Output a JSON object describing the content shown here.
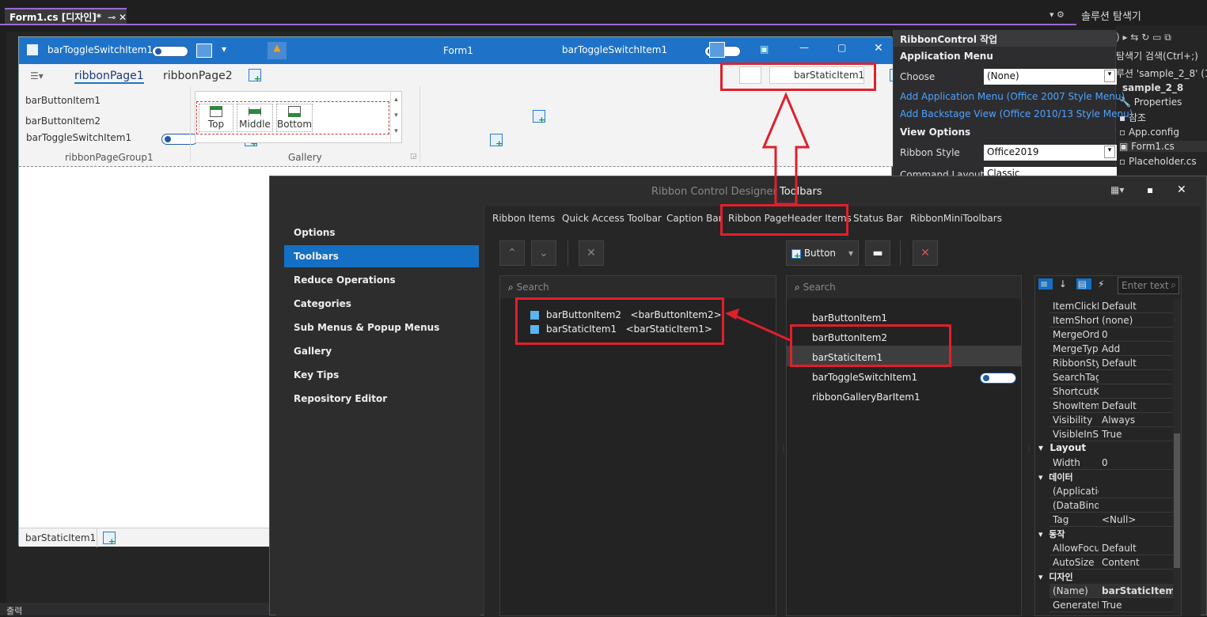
{
  "vs": {
    "doc_tab": "Form1.cs [디자인]*",
    "pin": "⊸ ✕",
    "solution_title": "솔루션 탐색기",
    "solution_search": "탐색기 검색(Ctrl+;)",
    "solution_line": "루션 'sample_2_8' (1",
    "project": "sample_2_8",
    "items": [
      "Properties",
      "참조",
      "App.config",
      "Form1.cs",
      "Placeholder.cs"
    ]
  },
  "smart_tag": {
    "title": "RibbonControl 작업",
    "app_menu_header": "Application Menu",
    "choose_label": "Choose",
    "choose_value": "(None)",
    "link1": "Add Application Menu (Office 2007 Style Menu)",
    "link2": "Add Backstage View (Office 2010/13 Style Menu)",
    "view_header": "View Options",
    "style_label": "Ribbon Style",
    "style_value": "Office2019",
    "cmd_label": "Command Layout",
    "cmd_value": "Classic"
  },
  "form": {
    "qat_toggle_label": "barToggleSwitchItem1",
    "title": "Form1",
    "caption_toggle_label": "barToggleSwitchItem1",
    "page_tabs": [
      "ribbonPage1",
      "ribbonPage2"
    ],
    "header_static": "barStaticItem1",
    "group1_items": [
      "barButtonItem1",
      "barButtonItem2",
      "barToggleSwitchItem1"
    ],
    "group1_label": "ribbonPageGroup1",
    "gallery_items": [
      "Top",
      "Middle",
      "Bottom"
    ],
    "gallery_label": "Gallery",
    "status_static": "barStaticItem1"
  },
  "designer": {
    "title_prefix": "Ribbon Control Designer",
    "title_section": "Toolbars",
    "nav": [
      "Options",
      "Toolbars",
      "Reduce Operations",
      "Categories",
      "Sub Menus & Popup Menus",
      "Gallery",
      "Key Tips",
      "Repository Editor"
    ],
    "selected_nav": "Toolbars",
    "tabs": [
      "Ribbon Items",
      "Quick Access Toolbar",
      "Caption Bar",
      "Ribbon PageHeader Items",
      "Status Bar",
      "RibbonMiniToolbars"
    ],
    "left_search": "Search",
    "right_search": "Search",
    "button_dropdown": "Button",
    "left_list": [
      {
        "name": "barButtonItem2",
        "tag": "<barButtonItem2>"
      },
      {
        "name": "barStaticItem1",
        "tag": "<barStaticItem1>"
      }
    ],
    "right_list": [
      "barButtonItem1",
      "barButtonItem2",
      "barStaticItem1",
      "barToggleSwitchItem1",
      "ribbonGalleryBarItem1"
    ],
    "prop_search": "Enter text",
    "props_top": [
      {
        "k": "ItemClickFi",
        "v": "Default"
      },
      {
        "k": "ItemShortc",
        "v": "(none)"
      },
      {
        "k": "MergeOrde",
        "v": "0"
      },
      {
        "k": "MergeType",
        "v": "Add"
      },
      {
        "k": "RibbonStyl",
        "v": "Default"
      },
      {
        "k": "SearchTag",
        "v": ""
      },
      {
        "k": "ShortcutKe",
        "v": ""
      },
      {
        "k": "ShowItem",
        "v": "Default"
      },
      {
        "k": "Visibility",
        "v": "Always"
      },
      {
        "k": "VisibleInSe",
        "v": "True"
      }
    ],
    "cat_layout": "Layout",
    "prop_width": {
      "k": "Width",
      "v": "0"
    },
    "cat_data": "데이터",
    "props_data": [
      {
        "k": "(Applicatio",
        "v": ""
      },
      {
        "k": "(DataBindi",
        "v": ""
      },
      {
        "k": "Tag",
        "v": "<Null>"
      }
    ],
    "cat_behavior": "동작",
    "props_behavior": [
      {
        "k": "AllowFocus",
        "v": "Default"
      },
      {
        "k": "AutoSize",
        "v": "Content"
      }
    ],
    "cat_design": "디자인",
    "props_design": [
      {
        "k": "(Name)",
        "v": "barStaticItem"
      },
      {
        "k": "GenerateM",
        "v": "True"
      }
    ]
  },
  "bottom_label": "출력"
}
